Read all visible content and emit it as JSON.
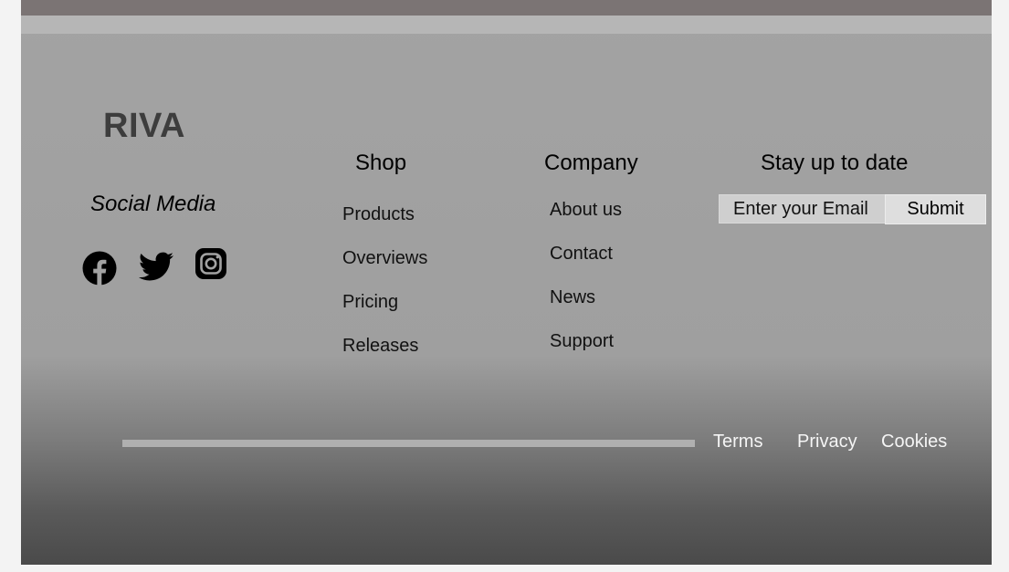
{
  "footer": {
    "logo": "RIVA",
    "social": {
      "title": "Social Media",
      "icons": [
        "facebook-icon",
        "twitter-icon",
        "instagram-icon"
      ]
    },
    "shop": {
      "title": "Shop",
      "links": [
        "Products",
        "Overviews",
        "Pricing",
        "Releases"
      ]
    },
    "company": {
      "title": "Company",
      "links": [
        "About us",
        "Contact",
        "News",
        "Support"
      ]
    },
    "newsletter": {
      "title": "Stay up to date",
      "email_placeholder": "Enter your Email",
      "email_value": "",
      "submit_label": "Submit"
    },
    "legal": {
      "links": [
        "Terms",
        "Privacy",
        "Cookies"
      ]
    }
  },
  "colors": {
    "top_bar": "#7b7474",
    "light_band": "#b6b6b6",
    "footer_top": "#a3a3a3",
    "footer_bottom": "#4a4a4a",
    "logo": "#3d3d3d",
    "legal_text": "#f5f5f5"
  }
}
